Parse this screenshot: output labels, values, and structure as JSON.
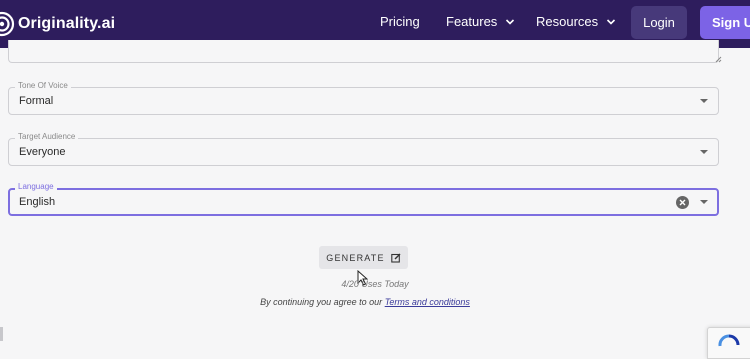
{
  "navbar": {
    "brand": "Originality.ai",
    "links": [
      {
        "label": "Pricing",
        "has_dropdown": false
      },
      {
        "label": "Features",
        "has_dropdown": true
      },
      {
        "label": "Resources",
        "has_dropdown": true
      }
    ],
    "login_label": "Login",
    "signup_label": "Sign Up"
  },
  "form": {
    "tone": {
      "label": "Tone Of Voice",
      "value": "Formal"
    },
    "audience": {
      "label": "Target Audience",
      "value": "Everyone"
    },
    "language": {
      "label": "Language",
      "value": "English"
    }
  },
  "generate": {
    "label": "GENERATE",
    "usage": "4/20 Uses Today",
    "terms_prefix": "By continuing you agree to our ",
    "terms_link": "Terms and conditions"
  },
  "colors": {
    "navbar_bg": "#2e1d5d",
    "signup_bg": "#7c63e6",
    "login_bg": "#47397a",
    "focus_border": "#7d6fe0"
  }
}
